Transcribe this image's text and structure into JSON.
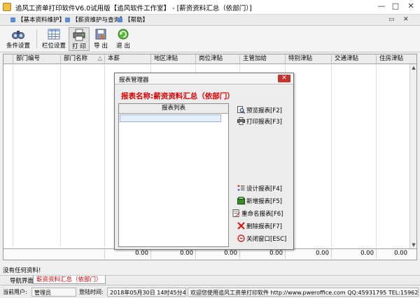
{
  "window": {
    "title": "追风工资单打印软件V6.0试用版【追风软件工作室】 - [薪资资料汇总（依部门）]",
    "min": "—",
    "max": "□",
    "close": "✕"
  },
  "menu": {
    "items": [
      "【基本资料维护】",
      "【薪资维护与查询】",
      "【帮助】"
    ],
    "right_icons": [
      "▭",
      "✕"
    ]
  },
  "toolbar": {
    "condition": "条件设置",
    "columns": "栏位设置",
    "print": "打 印",
    "export": "导 出",
    "exit": "退 出"
  },
  "grid": {
    "headers": [
      "部门编号",
      "部门名称",
      "本薪",
      "地区津贴",
      "岗位津贴",
      "主管加给",
      "特别津贴",
      "交通津贴",
      "住房津贴"
    ],
    "sort_marker": "△",
    "footer_values": [
      "0.00",
      "0.00",
      "0.00",
      "0.00",
      "0.00",
      "0.00",
      "0.00"
    ]
  },
  "status": {
    "message": "没有任何资料!",
    "nav_label": "导航界面",
    "nav_tab": "薪资资料汇总（依部门）",
    "user_label": "当前用户:",
    "user": "管理员",
    "login_label": "登陆时间:",
    "login_time": "2018年05月30日 14时45分42秒",
    "welcome": "欢迎您使用追风工资单打印软件 http://www.pweroffice.com QQ:45931795 TEL:15962648"
  },
  "dialog": {
    "title": "报表管理器",
    "close": "✕",
    "report_name": "报表名称:薪资资料汇总（依部门）",
    "list_header": "报表列表",
    "buttons": {
      "preview": "预览报表[F2]",
      "print": "打印报表[F3]",
      "design": "设计报表[F4]",
      "new": "新增报表[F5]",
      "rename": "重命名报表[F6]",
      "delete": "删除报表[F7]",
      "close": "关闭窗口[ESC]"
    }
  },
  "colors": {
    "report_name": "#e00000",
    "nav_tab": "#d00000",
    "dialog_close": "#c8322a"
  }
}
